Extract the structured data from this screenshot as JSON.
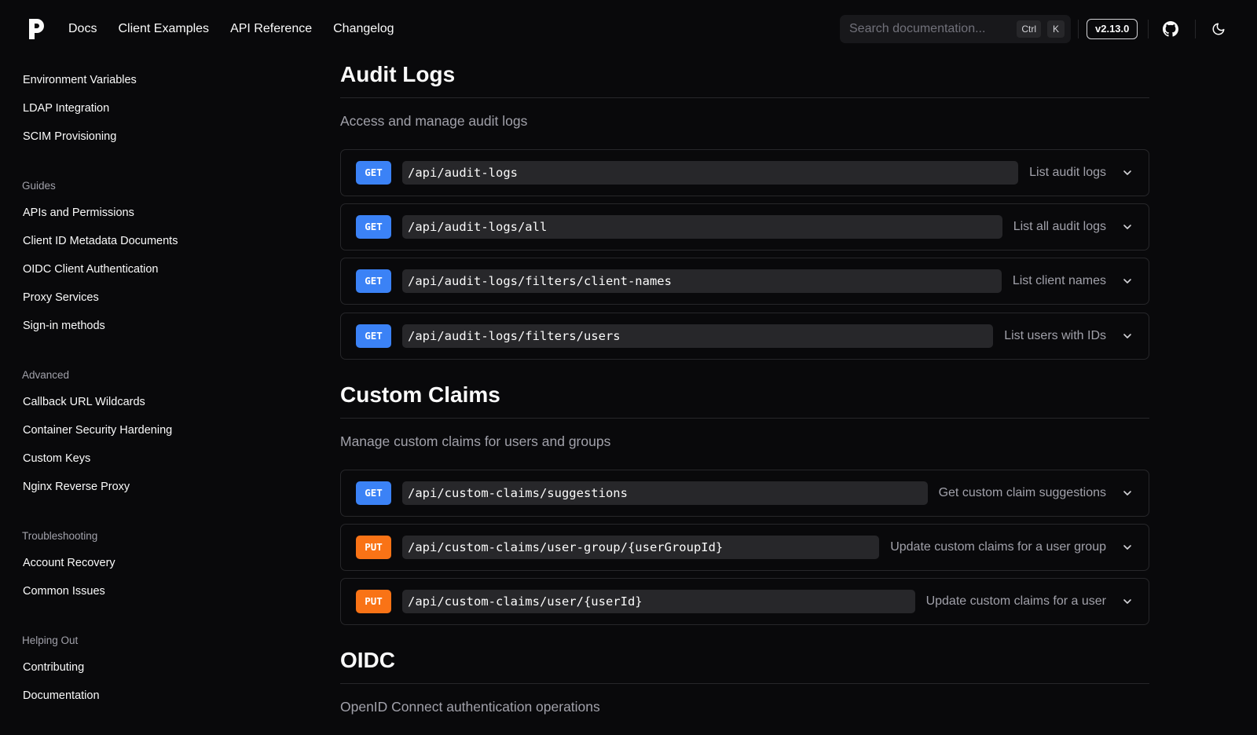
{
  "nav": {
    "links": [
      "Docs",
      "Client Examples",
      "API Reference",
      "Changelog"
    ],
    "search_placeholder": "Search documentation...",
    "search_shortcut": [
      "Ctrl",
      "K"
    ],
    "version": "v2.13.0"
  },
  "sidebar": {
    "items_top": [
      "Environment Variables",
      "LDAP Integration",
      "SCIM Provisioning"
    ],
    "groups": [
      {
        "heading": "Guides",
        "items": [
          "APIs and Permissions",
          "Client ID Metadata Documents",
          "OIDC Client Authentication",
          "Proxy Services",
          "Sign-in methods"
        ]
      },
      {
        "heading": "Advanced",
        "items": [
          "Callback URL Wildcards",
          "Container Security Hardening",
          "Custom Keys",
          "Nginx Reverse Proxy"
        ]
      },
      {
        "heading": "Troubleshooting",
        "items": [
          "Account Recovery",
          "Common Issues"
        ]
      },
      {
        "heading": "Helping Out",
        "items": [
          "Contributing",
          "Documentation"
        ]
      }
    ]
  },
  "sections": [
    {
      "title": "Audit Logs",
      "description": "Access and manage audit logs",
      "endpoints": [
        {
          "method": "GET",
          "path": "/api/audit-logs",
          "summary": "List audit logs"
        },
        {
          "method": "GET",
          "path": "/api/audit-logs/all",
          "summary": "List all audit logs"
        },
        {
          "method": "GET",
          "path": "/api/audit-logs/filters/client-names",
          "summary": "List client names"
        },
        {
          "method": "GET",
          "path": "/api/audit-logs/filters/users",
          "summary": "List users with IDs"
        }
      ]
    },
    {
      "title": "Custom Claims",
      "description": "Manage custom claims for users and groups",
      "endpoints": [
        {
          "method": "GET",
          "path": "/api/custom-claims/suggestions",
          "summary": "Get custom claim suggestions"
        },
        {
          "method": "PUT",
          "path": "/api/custom-claims/user-group/{userGroupId}",
          "summary": "Update custom claims for a user group"
        },
        {
          "method": "PUT",
          "path": "/api/custom-claims/user/{userId}",
          "summary": "Update custom claims for a user"
        }
      ]
    },
    {
      "title": "OIDC",
      "description": "OpenID Connect authentication operations",
      "endpoints": []
    }
  ],
  "colors": {
    "get": "#3b82f6",
    "put": "#f97316",
    "background": "#09090b"
  },
  "icons": {
    "logo": "pocket-id-logo",
    "github": "github-icon",
    "theme": "moon-icon",
    "expand": "chevron-down-icon"
  }
}
